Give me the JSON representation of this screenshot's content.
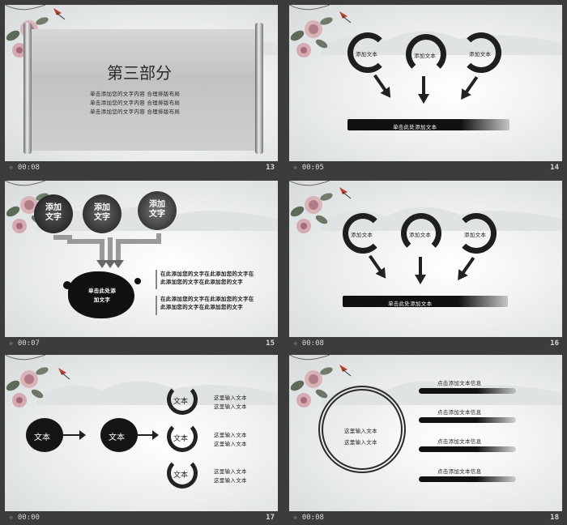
{
  "slides": [
    {
      "time": "00:08",
      "number": "13",
      "title": "第三部分",
      "lines": [
        "单击添加您的文字内容  合理排版布局",
        "单击添加您的文字内容  合理排版布局",
        "单击添加您的文字内容  合理排版布局"
      ]
    },
    {
      "time": "00:05",
      "number": "14",
      "circles": [
        "添加文本",
        "添加文本",
        "添加文本"
      ],
      "bar": "单击此处添加文本"
    },
    {
      "time": "00:07",
      "number": "15",
      "circles": [
        "添加文字",
        "添加文字",
        "添加文字"
      ],
      "blob": "单击此处添加文字",
      "para1": "在此添加您的文字在此添加您的文字在此添加您的文字在此添加您的文字",
      "para2": "在此添加您的文字在此添加您的文字在此添加您的文字在此添加您的文字"
    },
    {
      "time": "00:08",
      "number": "16",
      "circles": [
        "添加文本",
        "添加文本",
        "添加文本"
      ],
      "bar": "单击此处添加文本"
    },
    {
      "time": "00:00",
      "number": "17",
      "blobs": [
        "文本",
        "文本"
      ],
      "rings": [
        "文本",
        "文本",
        "文本"
      ],
      "items": [
        [
          "这里输入文本",
          "这里输入文本"
        ],
        [
          "这里输入文本",
          "这里输入文本"
        ],
        [
          "这里输入文本",
          "这里输入文本"
        ]
      ]
    },
    {
      "time": "00:08",
      "number": "18",
      "ring_lines": [
        "这里输入文本",
        "这里输入文本"
      ],
      "bars": [
        "点击添加文本信息",
        "点击添加文本信息",
        "点击添加文本信息",
        "点击添加文本信息"
      ]
    }
  ]
}
